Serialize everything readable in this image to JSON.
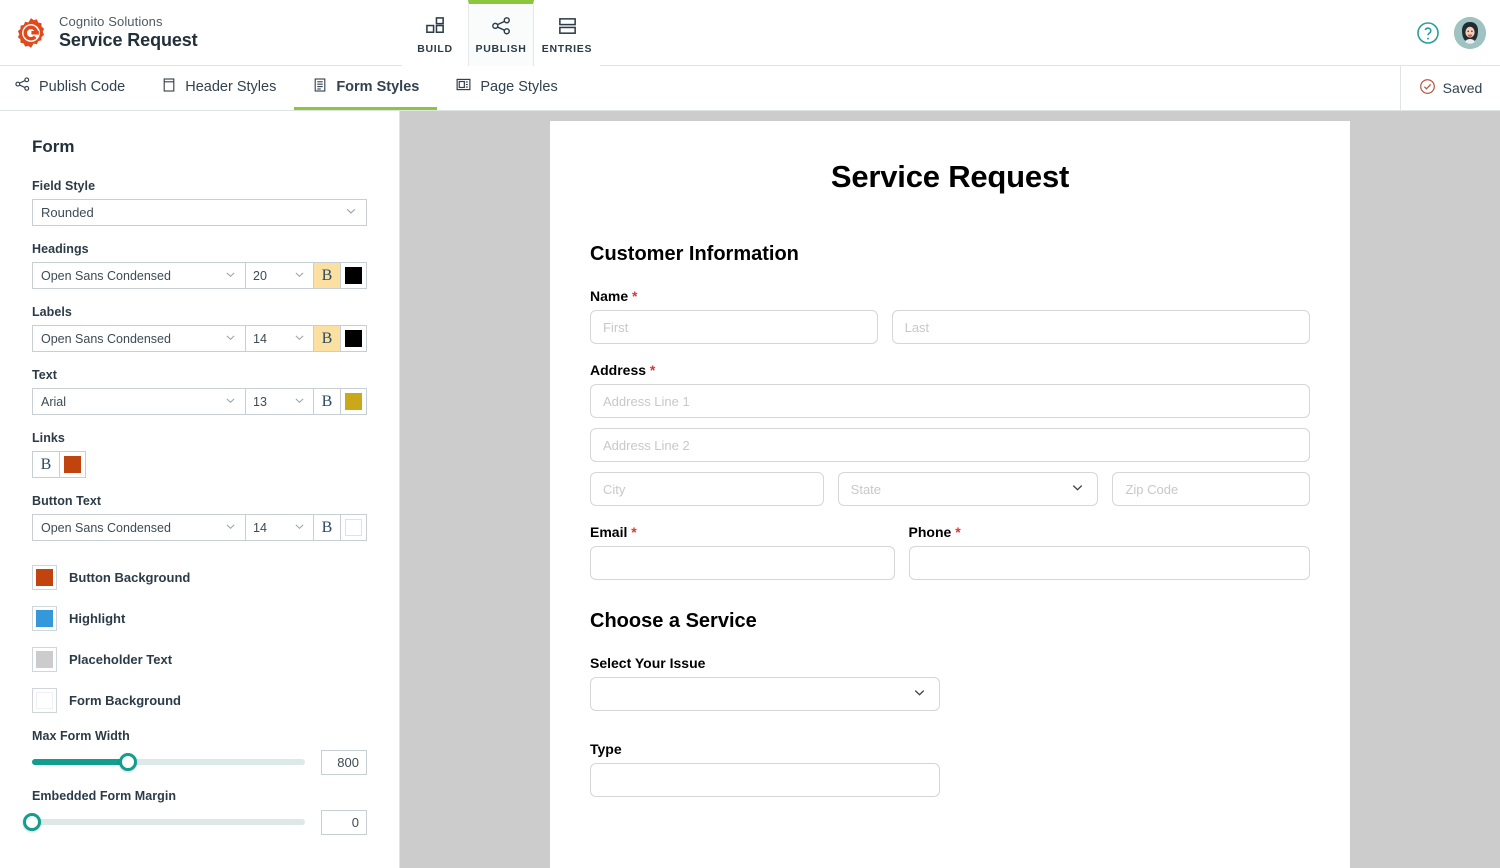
{
  "header": {
    "brand_sub": "Cognito Solutions",
    "brand_title": "Service Request",
    "logo_icon": "cog-logo-icon",
    "tabs": [
      {
        "label": "BUILD",
        "icon": "grid-squares-icon",
        "active": false
      },
      {
        "label": "PUBLISH",
        "icon": "share-nodes-icon",
        "active": true
      },
      {
        "label": "ENTRIES",
        "icon": "rows-icon",
        "active": false
      }
    ],
    "help_icon": "question-circle-icon",
    "avatar_icon": "user-avatar",
    "accent_green": "#8cc63e",
    "accent_teal": "#2a9d9d"
  },
  "subbar": {
    "tabs": [
      {
        "label": "Publish Code",
        "icon": "share-nodes-icon",
        "active": false
      },
      {
        "label": "Header Styles",
        "icon": "header-panel-icon",
        "active": false
      },
      {
        "label": "Form Styles",
        "icon": "form-lines-icon",
        "active": true
      },
      {
        "label": "Page Styles",
        "icon": "page-layout-icon",
        "active": false
      }
    ],
    "saved_label": "Saved",
    "saved_icon": "check-circle-icon"
  },
  "panel": {
    "title": "Form",
    "field_style": {
      "label": "Field Style",
      "value": "Rounded"
    },
    "typography": [
      {
        "label": "Headings",
        "font": "Open Sans Condensed",
        "size": "20",
        "bold_label": "B",
        "bold_on": true,
        "color": "#000000"
      },
      {
        "label": "Labels",
        "font": "Open Sans Condensed",
        "size": "14",
        "bold_label": "B",
        "bold_on": true,
        "color": "#000000"
      },
      {
        "label": "Text",
        "font": "Arial",
        "size": "13",
        "bold_label": "B",
        "bold_on": false,
        "color": "#c9a91a"
      }
    ],
    "links": {
      "label": "Links",
      "bold_label": "B",
      "bold_on": false,
      "color": "#c1440e"
    },
    "button_text": {
      "label": "Button Text",
      "font": "Open Sans Condensed",
      "size": "14",
      "bold_label": "B",
      "bold_on": false,
      "color": "#ffffff"
    },
    "colors": [
      {
        "label": "Button Background",
        "color": "#c1440e"
      },
      {
        "label": "Highlight",
        "color": "#3498db"
      },
      {
        "label": "Placeholder Text",
        "color": "#cccccc"
      },
      {
        "label": "Form Background",
        "color": "#ffffff"
      }
    ],
    "sliders": [
      {
        "label": "Max Form Width",
        "value": "800",
        "percent": 35
      },
      {
        "label": "Embedded Form Margin",
        "value": "0",
        "percent": 0
      }
    ]
  },
  "form_preview": {
    "title": "Service Request",
    "sections": [
      {
        "heading": "Customer Information",
        "fields": [
          {
            "label": "Name",
            "required": true,
            "inputs": [
              {
                "placeholder": "First",
                "type": "text",
                "flex": 1
              },
              {
                "placeholder": "Last",
                "type": "text",
                "flex": 1.5
              }
            ]
          },
          {
            "label": "Address",
            "required": true,
            "rows": [
              [
                {
                  "placeholder": "Address Line 1",
                  "type": "text",
                  "flex": 1
                }
              ],
              [
                {
                  "placeholder": "Address Line 2",
                  "type": "text",
                  "flex": 1
                }
              ],
              [
                {
                  "placeholder": "City",
                  "type": "text",
                  "flex": 1.15
                },
                {
                  "placeholder": "State",
                  "type": "select",
                  "flex": 1.3
                },
                {
                  "placeholder": "Zip Code",
                  "type": "text",
                  "flex": 0.95
                }
              ]
            ]
          },
          {
            "pair": [
              {
                "label": "Email",
                "required": true,
                "placeholder": "",
                "type": "text"
              },
              {
                "label": "Phone",
                "required": true,
                "placeholder": "",
                "type": "text"
              }
            ]
          }
        ]
      },
      {
        "heading": "Choose a Service",
        "fields": [
          {
            "label": "Select Your Issue",
            "required": false,
            "placeholder": "",
            "type": "select",
            "half": true
          },
          {
            "label": "Type",
            "required": false,
            "placeholder": "",
            "type": "text",
            "half": true
          }
        ]
      }
    ],
    "required_marker": "*"
  }
}
